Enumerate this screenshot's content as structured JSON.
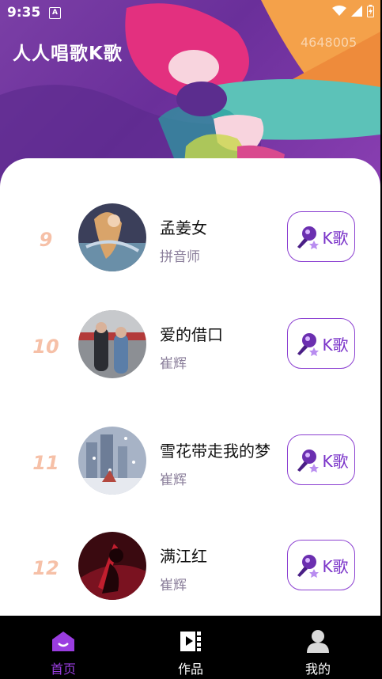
{
  "status_bar": {
    "time": "9:35",
    "notification_icon": "A",
    "icons": [
      "wifi-icon",
      "signal-icon",
      "battery-icon"
    ]
  },
  "app": {
    "title": "人人唱歌K歌",
    "counter": "4648005"
  },
  "songs": [
    {
      "rank": "9",
      "title": "孟姜女",
      "artist": "拼音师",
      "button": "K歌"
    },
    {
      "rank": "10",
      "title": "爱的借口",
      "artist": "崔辉",
      "button": "K歌"
    },
    {
      "rank": "11",
      "title": "雪花带走我的梦",
      "artist": "崔辉",
      "button": "K歌"
    },
    {
      "rank": "12",
      "title": "满江红",
      "artist": "崔辉",
      "button": "K歌"
    }
  ],
  "tabs": [
    {
      "label": "首页",
      "icon": "home-icon",
      "active": true
    },
    {
      "label": "作品",
      "icon": "works-icon",
      "active": false
    },
    {
      "label": "我的",
      "icon": "profile-icon",
      "active": false
    }
  ],
  "colors": {
    "accent": "#8b3fd1",
    "rank": "#f6c0a7",
    "artist": "#8a7e9a"
  }
}
